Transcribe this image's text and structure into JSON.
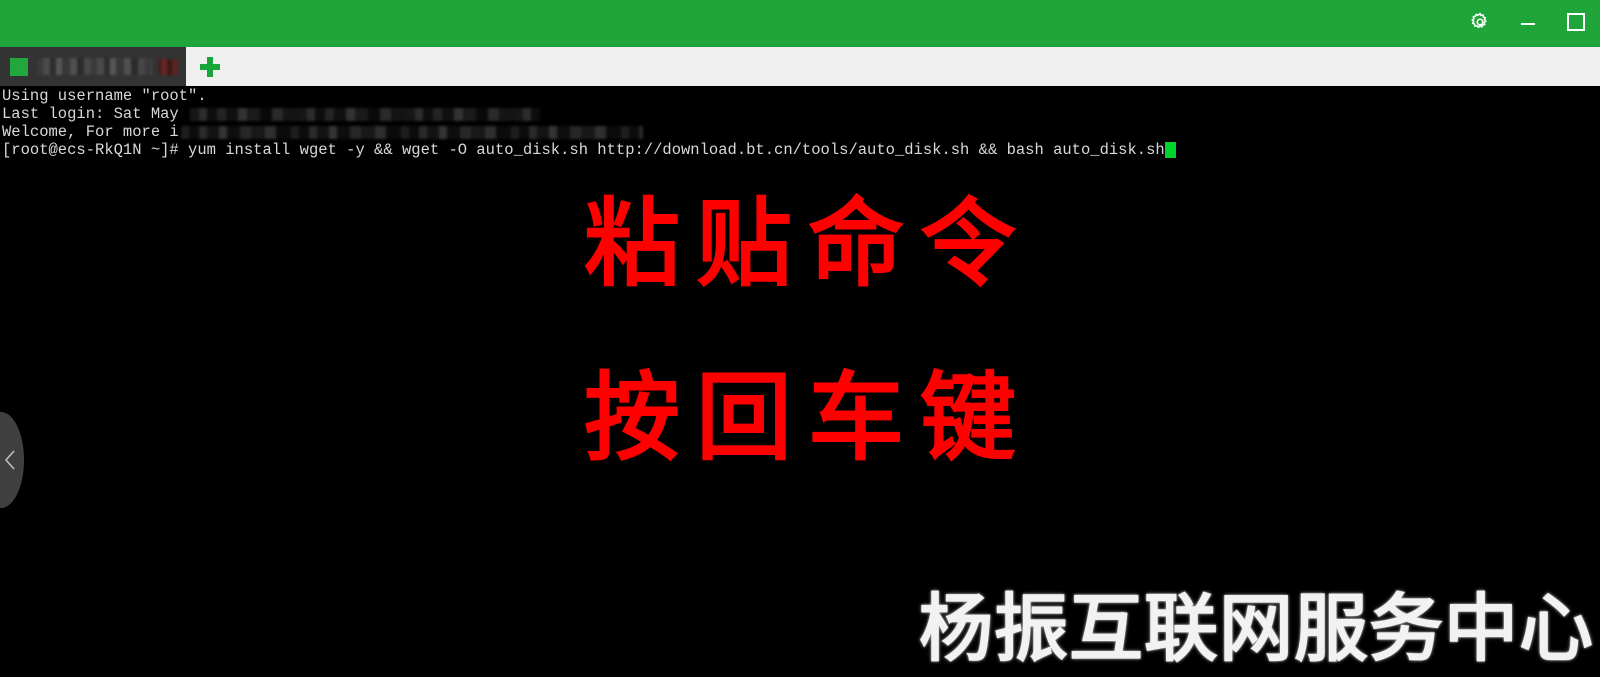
{
  "window": {
    "header_color": "#20a53a",
    "controls": [
      {
        "name": "settings-button",
        "icon": "gear-icon",
        "label": "设置"
      },
      {
        "name": "minimize-button",
        "icon": "minimize-icon",
        "label": "最小化"
      },
      {
        "name": "maximize-button",
        "icon": "maximize-icon",
        "label": "最大化"
      }
    ]
  },
  "tabstrip": {
    "background": "#efefef",
    "accent": "#1da337",
    "tabs": [
      {
        "label": "",
        "label_redacted": true,
        "icon": "terminal-session-icon",
        "close_icon": "close-icon",
        "active": true
      }
    ],
    "new_tab_label": "+"
  },
  "terminal": {
    "background": "#000000",
    "text_color": "#d8d8d8",
    "cursor_color": "#00d42b",
    "lines": [
      {
        "text": "Using username \"root\".",
        "redacted": null
      },
      {
        "text": "Last login: Sat May ",
        "redacted": "r1"
      },
      {
        "text": "Welcome, For more i",
        "redacted": "r2"
      },
      {
        "text": "[root@ecs-RkQ1N ~]# yum install wget -y && wget -O auto_disk.sh http://download.bt.cn/tools/auto_disk.sh && bash auto_disk.sh",
        "redacted": null,
        "cursor": true
      }
    ],
    "prompt": "[root@ecs-RkQ1N ~]#",
    "command": "yum install wget -y && wget -O auto_disk.sh http://download.bt.cn/tools/auto_disk.sh && bash auto_disk.sh"
  },
  "overlay": {
    "color": "#ff0000",
    "line1": "粘贴命令",
    "line2": "按回车键"
  },
  "nav": {
    "prev_icon": "chevron-left-icon",
    "prev_label": "上一步"
  },
  "watermark": {
    "text": "杨振互联网服务中心",
    "color": "#ffffff"
  }
}
